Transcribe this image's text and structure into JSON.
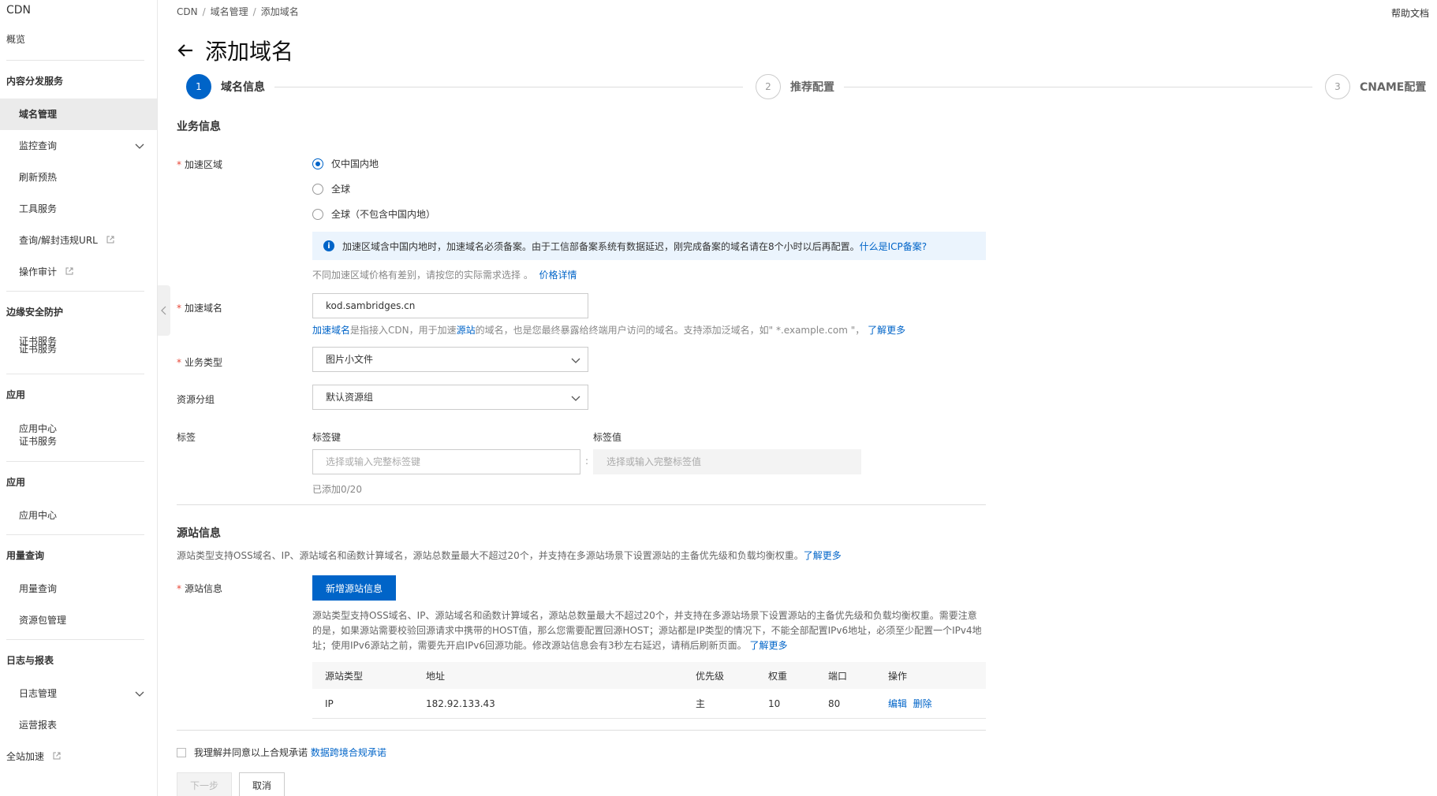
{
  "sidebar": {
    "title": "CDN",
    "overview": "概览",
    "sections": [
      {
        "title": "内容分发服务"
      },
      {
        "title": "边缘安全防护"
      },
      {
        "title": "应用"
      },
      {
        "title": "应用"
      },
      {
        "title": "用量查询"
      },
      {
        "title": "日志与报表"
      }
    ],
    "items": {
      "domain_mgmt": "域名管理",
      "monitor": "监控查询",
      "refresh": "刷新预热",
      "tools": "工具服务",
      "url_check": "查询/解封违规URL",
      "audit": "操作审计",
      "cert_a": "证书服务",
      "cert_b": "证书服务",
      "app_center_a": "应用中心",
      "cert_c": "证书服务",
      "app_center_b": "应用中心",
      "usage": "用量查询",
      "package": "资源包管理",
      "log_mgmt": "日志管理",
      "report": "运营报表",
      "dcdn": "全站加速"
    }
  },
  "breadcrumb": [
    "CDN",
    "域名管理",
    "添加域名"
  ],
  "help": "帮助文档",
  "page_title": "添加域名",
  "steps": [
    {
      "num": "1",
      "label": "域名信息"
    },
    {
      "num": "2",
      "label": "推荐配置"
    },
    {
      "num": "3",
      "label": "CNAME配置"
    }
  ],
  "business": {
    "title": "业务信息",
    "region_label": "加速区域",
    "region_options": [
      "仅中国内地",
      "全球",
      "全球（不包含中国内地）"
    ],
    "region_selected": "仅中国内地",
    "info_text": "加速区域含中国内地时，加速域名必须备案。由于工信部备案系统有数据延迟，刚完成备案的域名请在8个小时以后再配置。",
    "info_link": "什么是ICP备案?",
    "price_hint": "不同加速区域价格有差别，请按您的实际需求选择 。",
    "price_link": "价格详情",
    "domain_label": "加速域名",
    "domain_value": "kod.sambridges.cn",
    "domain_hint_link1": "加速域名",
    "domain_hint_1": "是指接入CDN，用于加速",
    "domain_hint_link2": "源站",
    "domain_hint_2": "的域名，也是您最终暴露给终端用户访问的域名。支持添加泛域名，如\" *.example.com \"，",
    "domain_hint_link3": "了解更多",
    "type_label": "业务类型",
    "type_value": "图片小文件",
    "group_label": "资源分组",
    "group_value": "默认资源组",
    "tag_label": "标签",
    "tag_key_label": "标签键",
    "tag_value_label": "标签值",
    "tag_key_placeholder": "选择或输入完整标签键",
    "tag_value_placeholder": "选择或输入完整标签值",
    "tag_colon": ":",
    "tag_count": "已添加0/20"
  },
  "origin": {
    "title": "源站信息",
    "subtitle": "源站类型支持OSS域名、IP、源站域名和函数计算域名，源站总数量最大不超过20个，并支持在多源站场景下设置源站的主备优先级和负载均衡权重。",
    "subtitle_link": "了解更多",
    "label": "源站信息",
    "add_button": "新增源站信息",
    "desc": "源站类型支持OSS域名、IP、源站域名和函数计算域名，源站总数量最大不超过20个，并支持在多源站场景下设置源站的主备优先级和负载均衡权重。需要注意的是，如果源站需要校验回源请求中携带的HOST值，那么您需要配置回源HOST；源站都是IP类型的情况下，不能全部配置IPv6地址，必须至少配置一个IPv4地址；使用IPv6源站之前，需要先开启IPv6回源功能。修改源站信息会有3秒左右延迟，请稍后刷新页面。",
    "desc_link": "了解更多",
    "table": {
      "headers": [
        "源站类型",
        "地址",
        "优先级",
        "权重",
        "端口",
        "操作"
      ],
      "rows": [
        {
          "type": "IP",
          "address": "182.92.133.43",
          "priority": "主",
          "weight": "10",
          "port": "80",
          "edit": "编辑",
          "delete": "删除"
        }
      ]
    }
  },
  "agree": {
    "text": "我理解并同意以上合规承诺",
    "link": "数据跨境合规承诺"
  },
  "buttons": {
    "next": "下一步",
    "cancel": "取消"
  },
  "colors": {
    "primary": "#0064c8",
    "required": "#e84738",
    "info_bg": "#ebf4fd"
  }
}
